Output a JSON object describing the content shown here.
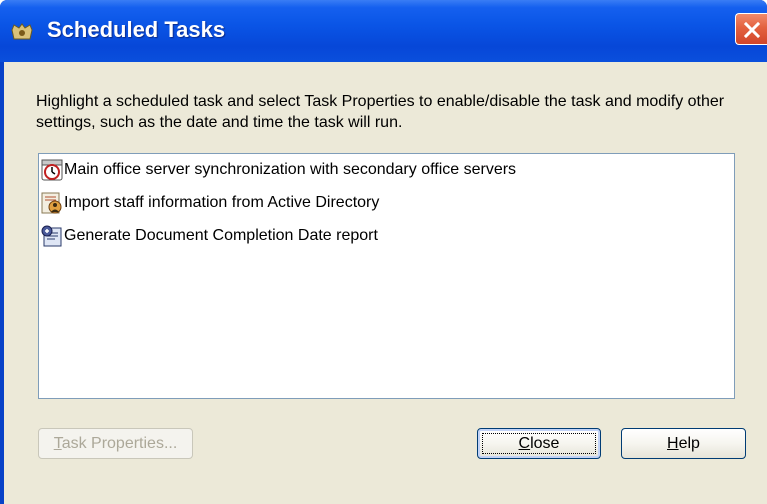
{
  "window": {
    "title": "Scheduled Tasks"
  },
  "instructions": "Highlight a scheduled task and select Task Properties to enable/disable the task and modify other settings, such as the date and time the task will run.",
  "tasks": [
    {
      "label": "Main office server synchronization with secondary office servers",
      "icon": "clock-icon"
    },
    {
      "label": "Import staff information from Active Directory",
      "icon": "directory-import-icon"
    },
    {
      "label": "Generate Document Completion Date report",
      "icon": "report-icon"
    }
  ],
  "buttons": {
    "task_properties": {
      "mnemonic": "T",
      "rest": "ask Properties...",
      "enabled": false
    },
    "close": {
      "mnemonic": "C",
      "rest": "lose"
    },
    "help": {
      "mnemonic": "H",
      "rest": "elp"
    }
  },
  "colors": {
    "titlebar": "#0a55e6",
    "dialog_background": "#ece9d8",
    "close_button": "#e3623f",
    "list_border": "#7f9db9"
  }
}
